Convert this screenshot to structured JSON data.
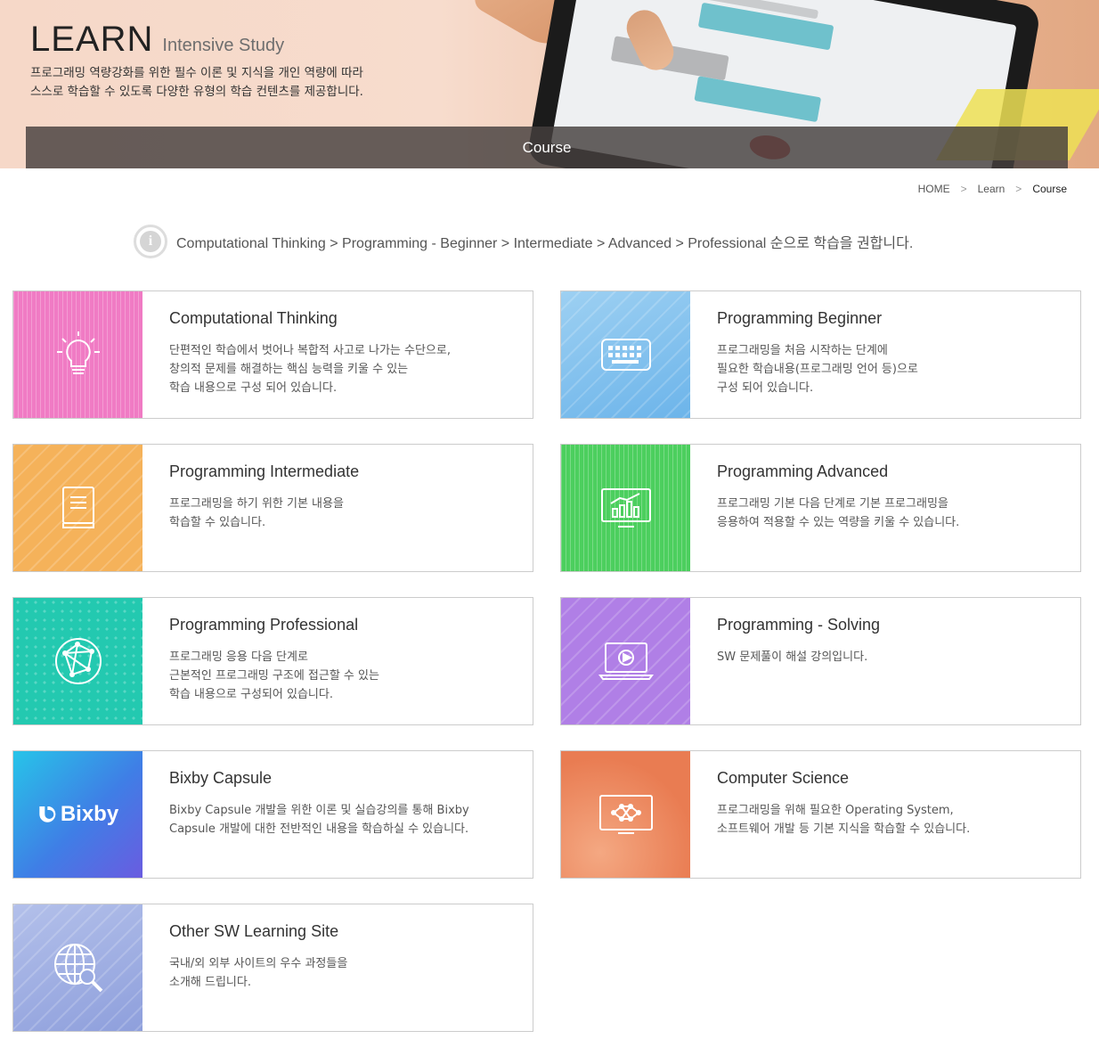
{
  "banner": {
    "title": "LEARN",
    "subtitle": "Intensive Study",
    "desc_line1": "프로그래밍 역량강화를 위한 필수 이론 및 지식을 개인 역량에 따라",
    "desc_line2": "스스로 학습할 수 있도록 다양한 유형의 학습 컨텐츠를 제공합니다.",
    "bar_label": "Course"
  },
  "breadcrumb": {
    "home": "HOME",
    "learn": "Learn",
    "current": "Course",
    "separator": ">"
  },
  "notice": {
    "text": "Computational Thinking > Programming - Beginner > Intermediate > Advanced > Professional 순으로 학습을 권합니다.",
    "icon": "info-icon"
  },
  "cards": [
    {
      "title": "Computational Thinking",
      "desc": "단편적인 학습에서 벗어나 복합적 사고로 나가는 수단으로,\n창의적 문제를 해결하는 핵심 능력을 키울 수 있는\n학습 내용으로 구성 되어 있습니다.",
      "icon": "lightbulb-icon",
      "color": "#f07bc4"
    },
    {
      "title": "Programming Beginner",
      "desc": "프로그래밍을 처음 시작하는 단계에\n필요한 학습내용(프로그래밍 언어 등)으로\n구성 되어 있습니다.",
      "icon": "keyboard-icon",
      "color": "#7cc0ee"
    },
    {
      "title": "Programming Intermediate",
      "desc": "프로그래밍을 하기 위한 기본 내용을\n학습할 수 있습니다.",
      "icon": "book-icon",
      "color": "#f5b25a"
    },
    {
      "title": "Programming Advanced",
      "desc": "프로그래밍 기본 다음 단계로 기본 프로그래밍을\n응용하여 적용할 수 있는 역량을 키울 수 있습니다.",
      "icon": "chart-monitor-icon",
      "color": "#4ccf5e"
    },
    {
      "title": "Programming Professional",
      "desc": "프로그래밍 응용 다음 단계로\n근본적인 프로그래밍 구조에 접근할 수 있는\n학습 내용으로 구성되어 있습니다.",
      "icon": "network-globe-icon",
      "color": "#23c9b0"
    },
    {
      "title": "Programming - Solving",
      "desc": "SW 문제풀이 해설 강의입니다.",
      "icon": "laptop-play-icon",
      "color": "#b07fe6"
    },
    {
      "title": "Bixby Capsule",
      "desc": "Bixby Capsule 개발을 위한 이론 및 실습강의를 통해 Bixby\nCapsule 개발에 대한 전반적인 내용을 학습하실 수 있습니다.",
      "icon": "bixby-logo",
      "logo_text": "Bixby",
      "color": "#3a8fe0"
    },
    {
      "title": "Computer Science",
      "desc": "프로그래밍을 위해 필요한 Operating System,\n소프트웨어 개발 등 기본 지식을 학습할 수 있습니다.",
      "icon": "network-monitor-icon",
      "color": "#ee8a5e"
    },
    {
      "title": "Other SW Learning Site",
      "desc": "국내/외 외부 사이트의 우수 과정들을\n소개해 드립니다.",
      "icon": "globe-search-icon",
      "color": "#9fb1e4"
    }
  ]
}
